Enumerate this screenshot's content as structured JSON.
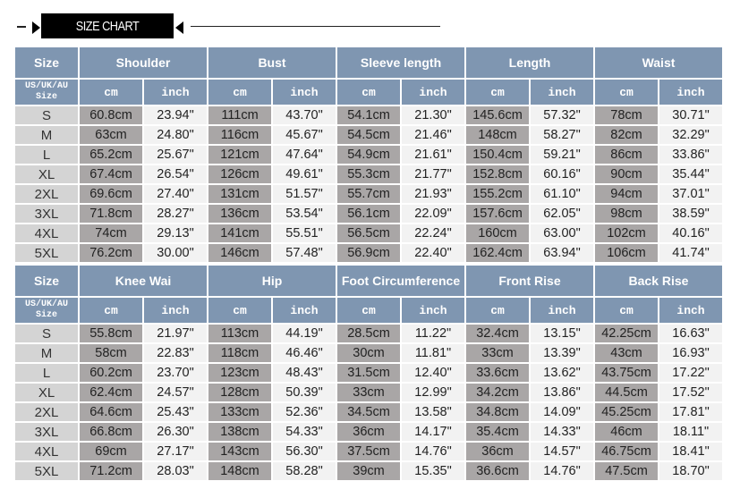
{
  "banner": {
    "title": "SIZE CHART"
  },
  "colors": {
    "header": "#7f96b1",
    "size_cell": "#d4d4d4",
    "cm_cell": "#a9a6a6",
    "inch_cell": "#f2f2f2"
  },
  "labels": {
    "size": "Size",
    "size_system": "US/UK/AU",
    "size_system_2": "Size",
    "cm": "cm",
    "inch": "inch"
  },
  "sizes": [
    "S",
    "M",
    "L",
    "XL",
    "2XL",
    "3XL",
    "4XL",
    "5XL"
  ],
  "tables": [
    {
      "measures": [
        {
          "name": "Shoulder",
          "cm": [
            "60.8cm",
            "63cm",
            "65.2cm",
            "67.4cm",
            "69.6cm",
            "71.8cm",
            "74cm",
            "76.2cm"
          ],
          "inch": [
            "23.94\"",
            "24.80\"",
            "25.67\"",
            "26.54\"",
            "27.40\"",
            "28.27\"",
            "29.13\"",
            "30.00\""
          ]
        },
        {
          "name": "Bust",
          "cm": [
            "111cm",
            "116cm",
            "121cm",
            "126cm",
            "131cm",
            "136cm",
            "141cm",
            "146cm"
          ],
          "inch": [
            "43.70\"",
            "45.67\"",
            "47.64\"",
            "49.61\"",
            "51.57\"",
            "53.54\"",
            "55.51\"",
            "57.48\""
          ]
        },
        {
          "name": "Sleeve length",
          "cm": [
            "54.1cm",
            "54.5cm",
            "54.9cm",
            "55.3cm",
            "55.7cm",
            "56.1cm",
            "56.5cm",
            "56.9cm"
          ],
          "inch": [
            "21.30\"",
            "21.46\"",
            "21.61\"",
            "21.77\"",
            "21.93\"",
            "22.09\"",
            "22.24\"",
            "22.40\""
          ]
        },
        {
          "name": "Length",
          "cm": [
            "145.6cm",
            "148cm",
            "150.4cm",
            "152.8cm",
            "155.2cm",
            "157.6cm",
            "160cm",
            "162.4cm"
          ],
          "inch": [
            "57.32\"",
            "58.27\"",
            "59.21\"",
            "60.16\"",
            "61.10\"",
            "62.05\"",
            "63.00\"",
            "63.94\""
          ]
        },
        {
          "name": "Waist",
          "cm": [
            "78cm",
            "82cm",
            "86cm",
            "90cm",
            "94cm",
            "98cm",
            "102cm",
            "106cm"
          ],
          "inch": [
            "30.71\"",
            "32.29\"",
            "33.86\"",
            "35.44\"",
            "37.01\"",
            "38.59\"",
            "40.16\"",
            "41.74\""
          ]
        }
      ]
    },
    {
      "measures": [
        {
          "name": "Knee Wai",
          "cm": [
            "55.8cm",
            "58cm",
            "60.2cm",
            "62.4cm",
            "64.6cm",
            "66.8cm",
            "69cm",
            "71.2cm"
          ],
          "inch": [
            "21.97\"",
            "22.83\"",
            "23.70\"",
            "24.57\"",
            "25.43\"",
            "26.30\"",
            "27.17\"",
            "28.03\""
          ]
        },
        {
          "name": "Hip",
          "cm": [
            "113cm",
            "118cm",
            "123cm",
            "128cm",
            "133cm",
            "138cm",
            "143cm",
            "148cm"
          ],
          "inch": [
            "44.19\"",
            "46.46\"",
            "48.43\"",
            "50.39\"",
            "52.36\"",
            "54.33\"",
            "56.30\"",
            "58.28\""
          ]
        },
        {
          "name": "Foot Circumference",
          "cm": [
            "28.5cm",
            "30cm",
            "31.5cm",
            "33cm",
            "34.5cm",
            "36cm",
            "37.5cm",
            "39cm"
          ],
          "inch": [
            "11.22\"",
            "11.81\"",
            "12.40\"",
            "12.99\"",
            "13.58\"",
            "14.17\"",
            "14.76\"",
            "15.35\""
          ]
        },
        {
          "name": "Front Rise",
          "cm": [
            "32.4cm",
            "33cm",
            "33.6cm",
            "34.2cm",
            "34.8cm",
            "35.4cm",
            "36cm",
            "36.6cm"
          ],
          "inch": [
            "13.15\"",
            "13.39\"",
            "13.62\"",
            "13.86\"",
            "14.09\"",
            "14.33\"",
            "14.57\"",
            "14.76\""
          ]
        },
        {
          "name": "Back Rise",
          "cm": [
            "42.25cm",
            "43cm",
            "43.75cm",
            "44.5cm",
            "45.25cm",
            "46cm",
            "46.75cm",
            "47.5cm"
          ],
          "inch": [
            "16.63\"",
            "16.93\"",
            "17.22\"",
            "17.52\"",
            "17.81\"",
            "18.11\"",
            "18.41\"",
            "18.70\""
          ]
        }
      ]
    }
  ]
}
